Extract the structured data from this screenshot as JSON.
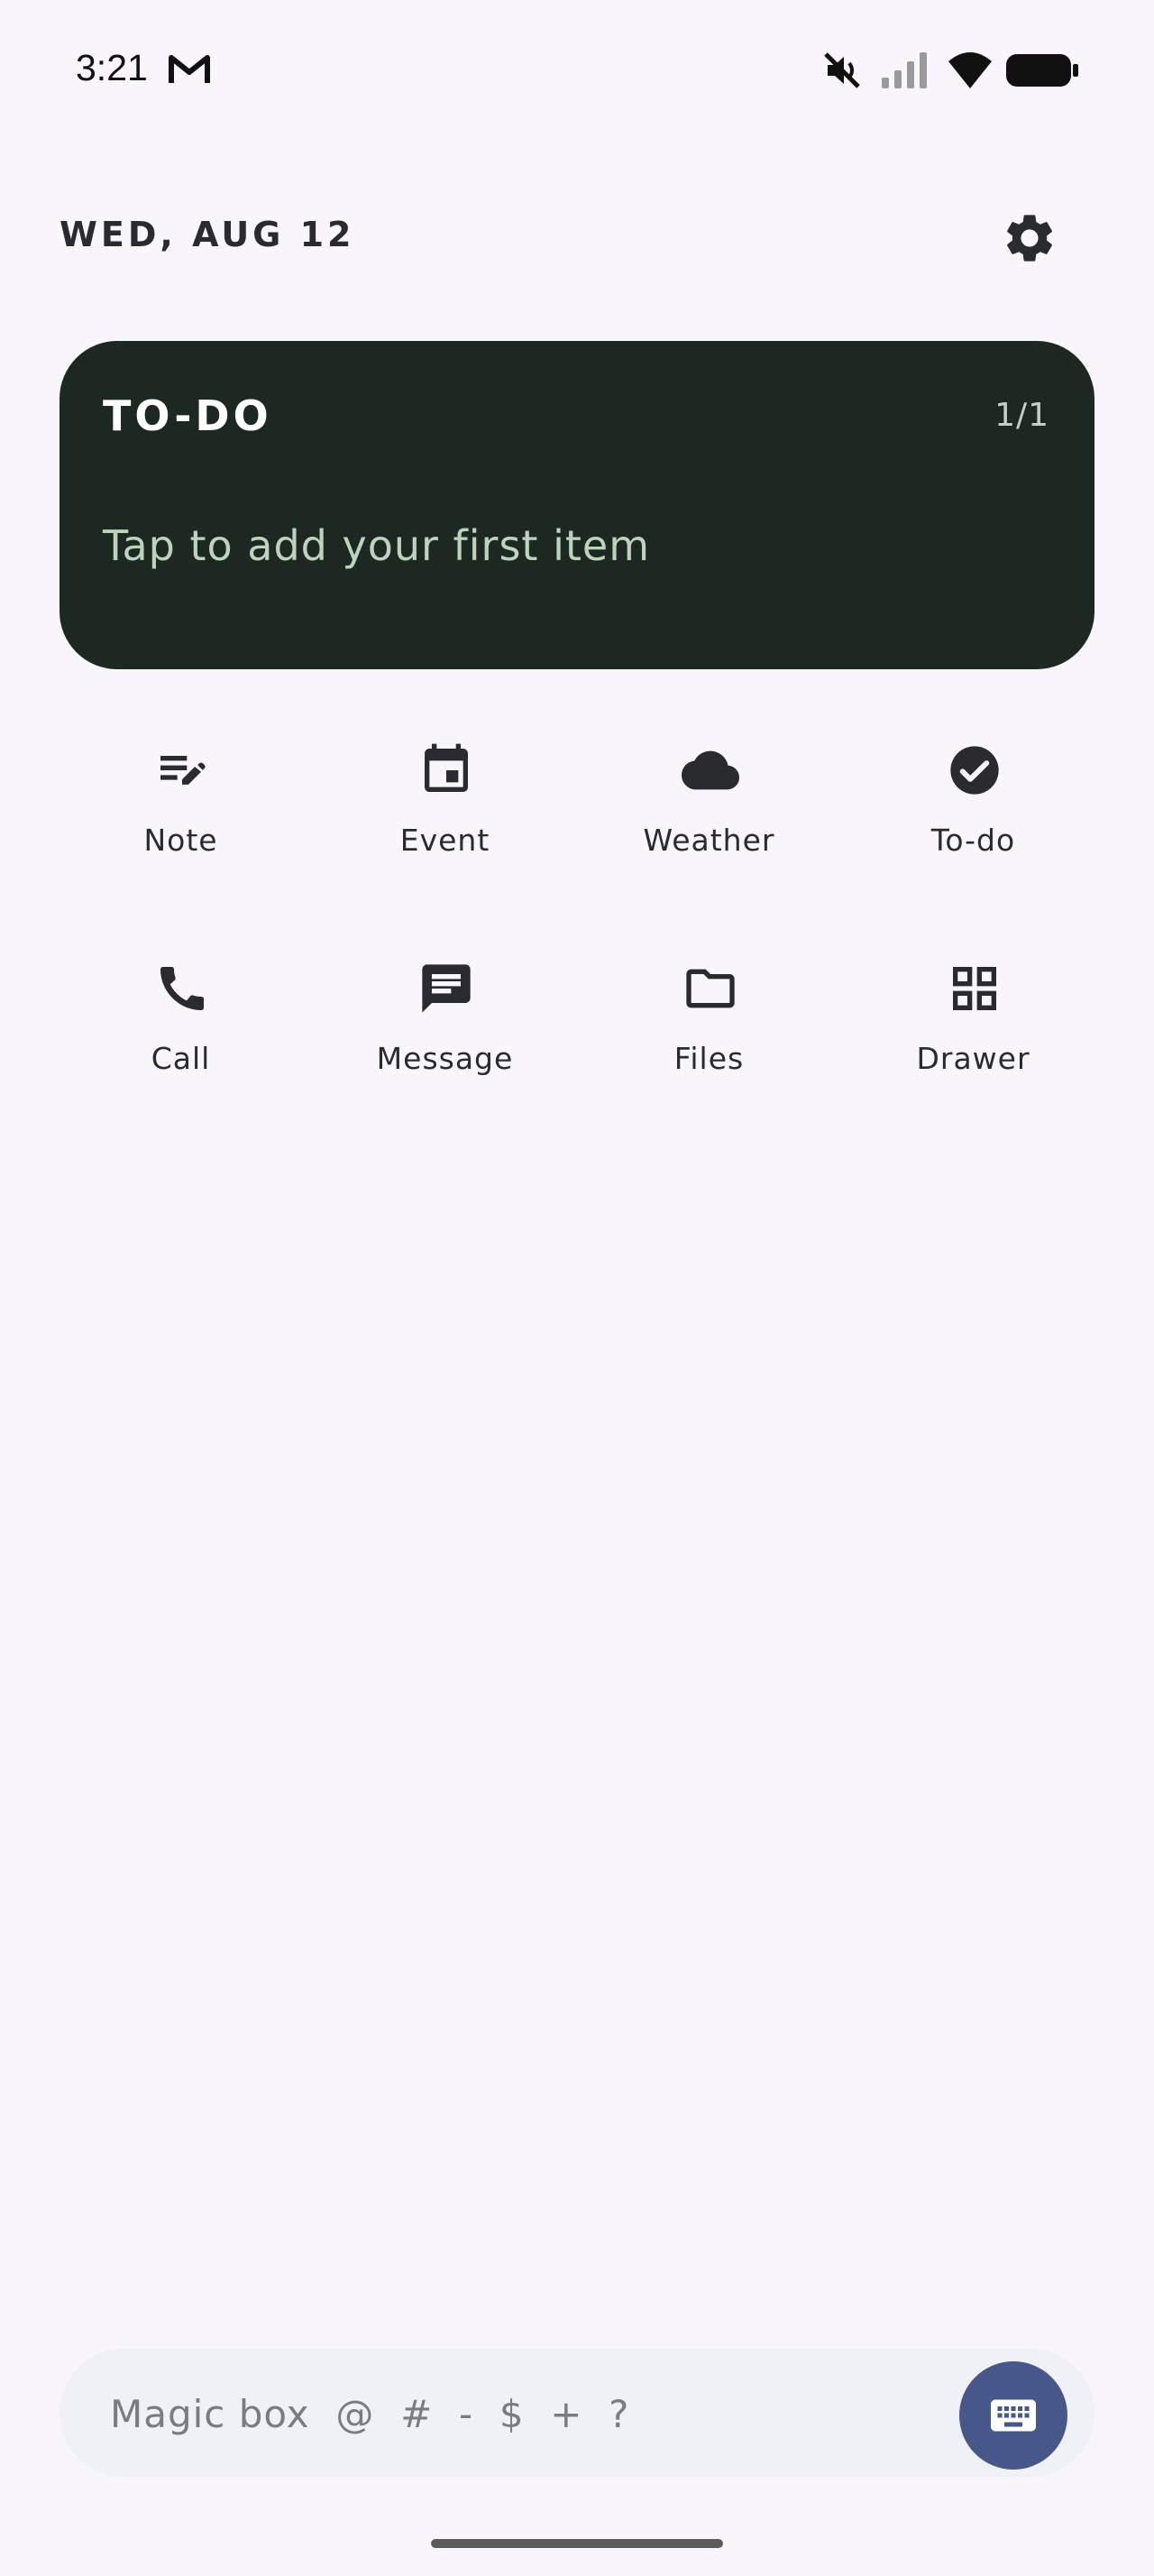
{
  "status_bar": {
    "time": "3:21",
    "icons": [
      "gmail-icon",
      "mute-icon",
      "signal-icon",
      "wifi-icon",
      "battery-icon"
    ]
  },
  "header": {
    "date": "WED, AUG 12",
    "settings_icon": "gear-icon"
  },
  "todo_card": {
    "title": "TO-DO",
    "count": "1/1",
    "hint": "Tap to add your first item",
    "background": "#1e2823",
    "hint_color": "#bcd4be"
  },
  "shortcuts": [
    {
      "label": "Note",
      "icon": "note-edit-icon"
    },
    {
      "label": "Event",
      "icon": "calendar-icon"
    },
    {
      "label": "Weather",
      "icon": "cloud-icon"
    },
    {
      "label": "To-do",
      "icon": "check-circle-icon"
    },
    {
      "label": "Call",
      "icon": "phone-icon"
    },
    {
      "label": "Message",
      "icon": "message-icon"
    },
    {
      "label": "Files",
      "icon": "folder-icon"
    },
    {
      "label": "Drawer",
      "icon": "grid-icon"
    }
  ],
  "magic_box": {
    "placeholder": "Magic box  @  #  -  $  +  ?",
    "button_icon": "keyboard-icon",
    "button_color": "#47578a"
  }
}
